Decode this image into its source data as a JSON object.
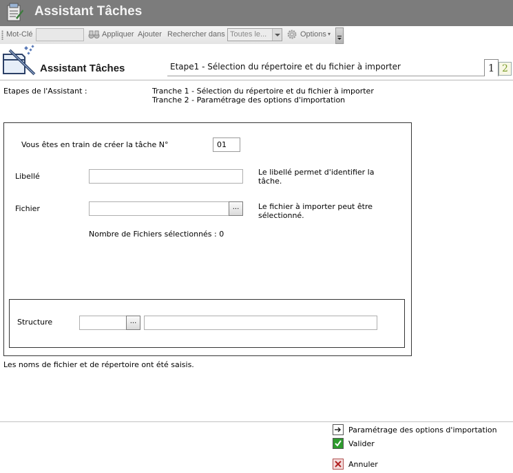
{
  "app": {
    "title": "Assistant Tâches"
  },
  "toolbar": {
    "keyword_label": "Mot-Clé",
    "keyword_value": "",
    "apply_label": "Appliquer",
    "add_label": "Ajouter",
    "search_in_label": "Rechercher dans",
    "search_scope_value": "Toutes le...",
    "options_label": "Options"
  },
  "wizard": {
    "title": "Assistant Tâches",
    "step_title": "Etape1 - Sélection du répertoire et du fichier à importer",
    "step_tabs": [
      "1",
      "2"
    ]
  },
  "steps": {
    "label": "Etapes de l'Assistant :",
    "items": [
      "Tranche 1 - Sélection du répertoire et du fichier à importer",
      "Tranche 2 - Paramétrage des options d'importation"
    ]
  },
  "form": {
    "task_number_label": "Vous êtes en train de créer la tâche N°",
    "task_number_value": "01",
    "libelle_label": "Libellé",
    "libelle_value": "",
    "libelle_help_1": "Le libellé permet d'identifier la",
    "libelle_help_2": "tâche.",
    "fichier_label": "Fichier",
    "fichier_value": "",
    "browse_label": "...",
    "fichier_help_1": "Le fichier à importer peut être",
    "fichier_help_2": "sélectionné.",
    "files_selected": "Nombre de Fichiers sélectionnés : 0",
    "structure_label": "Structure",
    "structure_code": "",
    "structure_desc": ""
  },
  "status": "Les noms de fichier et de répertoire ont été saisis.",
  "actions": {
    "next": "Paramétrage des options d'importation",
    "validate": "Valider",
    "cancel": "Annuler"
  },
  "colors": {
    "titlebar": "#7c7c7c",
    "validate_icon": "#2e9b2e",
    "cancel_icon": "#c0504d",
    "step2_tab": "#7a9d2a"
  }
}
